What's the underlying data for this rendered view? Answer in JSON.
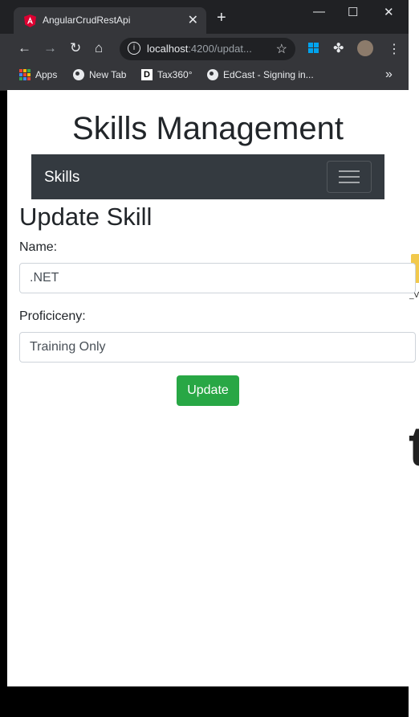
{
  "browser": {
    "tab_title": "AngularCrudRestApi",
    "tab_close": "✕",
    "new_tab": "+",
    "window_controls": {
      "minimize": "—",
      "maximize": "☐",
      "close": "✕"
    },
    "url_host": "localhost",
    "url_rest": ":4200/updat...",
    "bookmarks": [
      "Apps",
      "New Tab",
      "Tax360°",
      "EdCast - Signing in..."
    ],
    "bookmarks_more": "»"
  },
  "page": {
    "title": "Skills Management",
    "nav_brand": "Skills",
    "heading": "Update Skill",
    "name_label": "Name:",
    "name_value": ".NET",
    "proficiency_label": "Proficiceny:",
    "proficiency_value": "Training Only",
    "update_button": "Update"
  },
  "desktop": {
    "icon_label": "_V",
    "big_letter": "t"
  },
  "colors": {
    "navbar": "#343a40",
    "button": "#28a745",
    "chrome_dark": "#202124",
    "chrome_toolbar": "#35363a"
  }
}
